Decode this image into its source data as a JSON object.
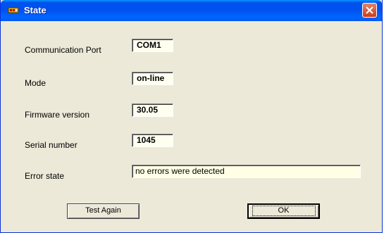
{
  "window": {
    "title": "State",
    "icon": "serial-device-icon",
    "close_icon": "close-icon"
  },
  "fields": {
    "communication_port": {
      "label": "Communication Port",
      "value": "COM1"
    },
    "mode": {
      "label": "Mode",
      "value": "on-line"
    },
    "firmware_version": {
      "label": "Firmware version",
      "value": "30.05"
    },
    "serial_number": {
      "label": "Serial number",
      "value": "1045"
    },
    "error_state": {
      "label": "Error state",
      "value": "no errors were detected"
    }
  },
  "buttons": {
    "test_again": "Test Again",
    "ok": "OK"
  },
  "colors": {
    "titlebar": "#0054e3",
    "dialog_bg": "#ece9d8",
    "close_button": "#d95b3a"
  }
}
